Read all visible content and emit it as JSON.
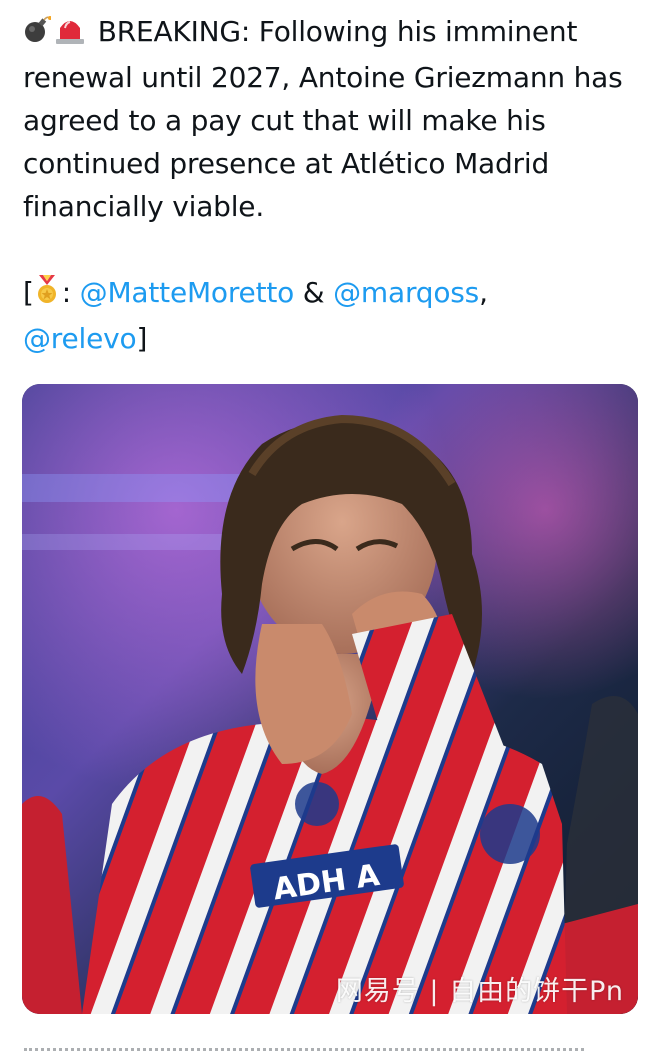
{
  "tweet": {
    "emoji_1": "bomb-icon",
    "emoji_2": "siren-icon",
    "body": "BREAKING: Following his imminent renewal until 2027, Antoine Griezmann has agreed to a pay cut that will make his continued presence at Atlético Madrid financially viable.",
    "sources": {
      "open_bracket": "[",
      "medal_icon": "medal-icon",
      "colon": ":",
      "mention_1": "@MatteMoretto",
      "and": "&",
      "mention_2": "@marqoss",
      "comma": ",",
      "mention_3": "@relevo",
      "close_bracket": "]"
    },
    "mention_color": "#1d9bf0",
    "text_color": "#0f1419"
  },
  "media": {
    "kind": "photo",
    "jersey_text": "ADH A",
    "watermark": "网易号 | 自由的饼干Pn"
  }
}
